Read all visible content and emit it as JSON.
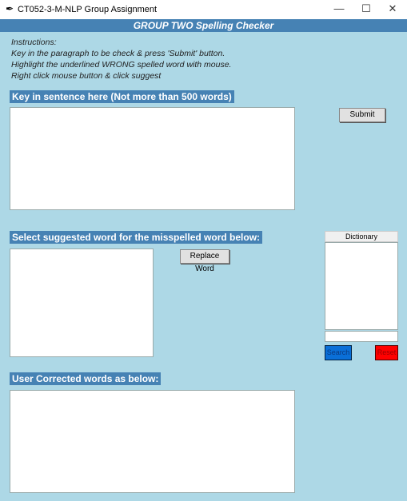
{
  "window": {
    "title": "CT052-3-M-NLP Group Assignment",
    "minimize": "—",
    "maximize": "☐",
    "close": "✕"
  },
  "header": "GROUP TWO Spelling Checker",
  "instructions": [
    "Instructions:",
    "Key in the paragraph to be check & press 'Submit' button.",
    "Highlight the underlined WRONG spelled word with mouse.",
    "Right click mouse button & click suggest"
  ],
  "input_label": "Key in sentence here (Not more than 500 words)",
  "submit": "Submit",
  "suggest_label": "Select suggested word for the misspelled word below:",
  "replace": "Replace Word",
  "dictionary": {
    "title": "Dictionary",
    "search": "Search",
    "reset": "Reset"
  },
  "corrected_label": "User Corrected words as below:"
}
